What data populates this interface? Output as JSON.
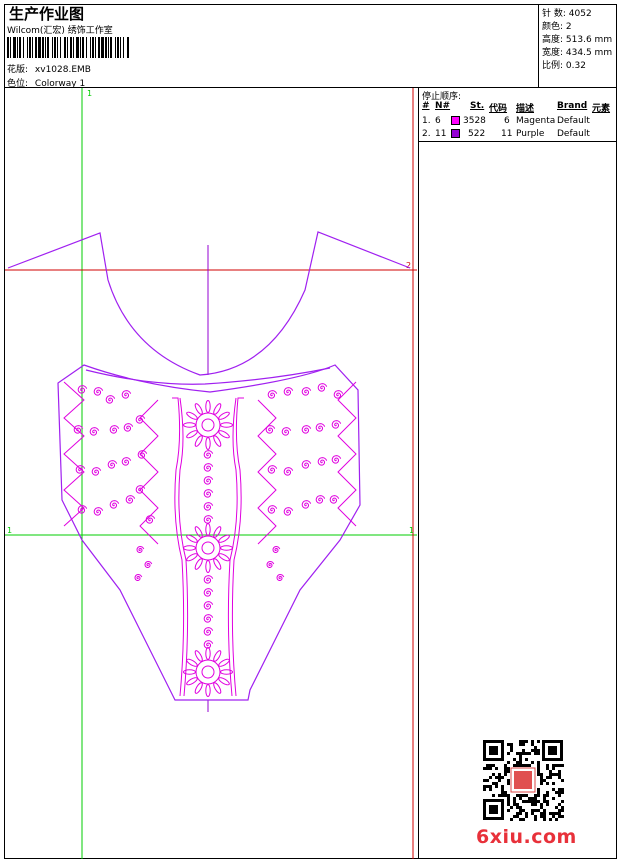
{
  "header": {
    "title": "生产作业图",
    "company": "Wilcom(汇宏) 绣饰工作室",
    "design_label": "花版:",
    "design_value": "xv1028.EMB",
    "colorway_label": "色位:",
    "colorway_value": "Colorway 1"
  },
  "specs": [
    {
      "label": "针 数:",
      "value": "4052"
    },
    {
      "label": "颜色:",
      "value": "2"
    },
    {
      "label": "高度:",
      "value": "513.6 mm"
    },
    {
      "label": "宽度:",
      "value": "434.5 mm"
    },
    {
      "label": "比例:",
      "value": "0.32"
    }
  ],
  "stop_sequence": {
    "label": "停止顺序:",
    "columns": [
      "#",
      "N#",
      "St.",
      "代码",
      "描述",
      "Brand",
      "元素"
    ],
    "rows": [
      {
        "idx": "1.",
        "needle": "6",
        "stitches": "3528",
        "code": "6",
        "desc": "Magenta",
        "brand": "Default",
        "color": "#ff00ff"
      },
      {
        "idx": "2.",
        "needle": "11",
        "stitches": "522",
        "code": "11",
        "desc": "Purple",
        "brand": "Default",
        "color": "#9400d3"
      }
    ]
  },
  "guides": {
    "v1_label": "1",
    "h2_label": "2",
    "h1_label": "1",
    "h1_label_right": "1"
  },
  "watermark": {
    "site": "6xiu.com"
  },
  "colors": {
    "magenta": "#e000e0",
    "purple": "#9400d3",
    "guide_green": "#00cc00",
    "guide_red": "#d00000"
  }
}
